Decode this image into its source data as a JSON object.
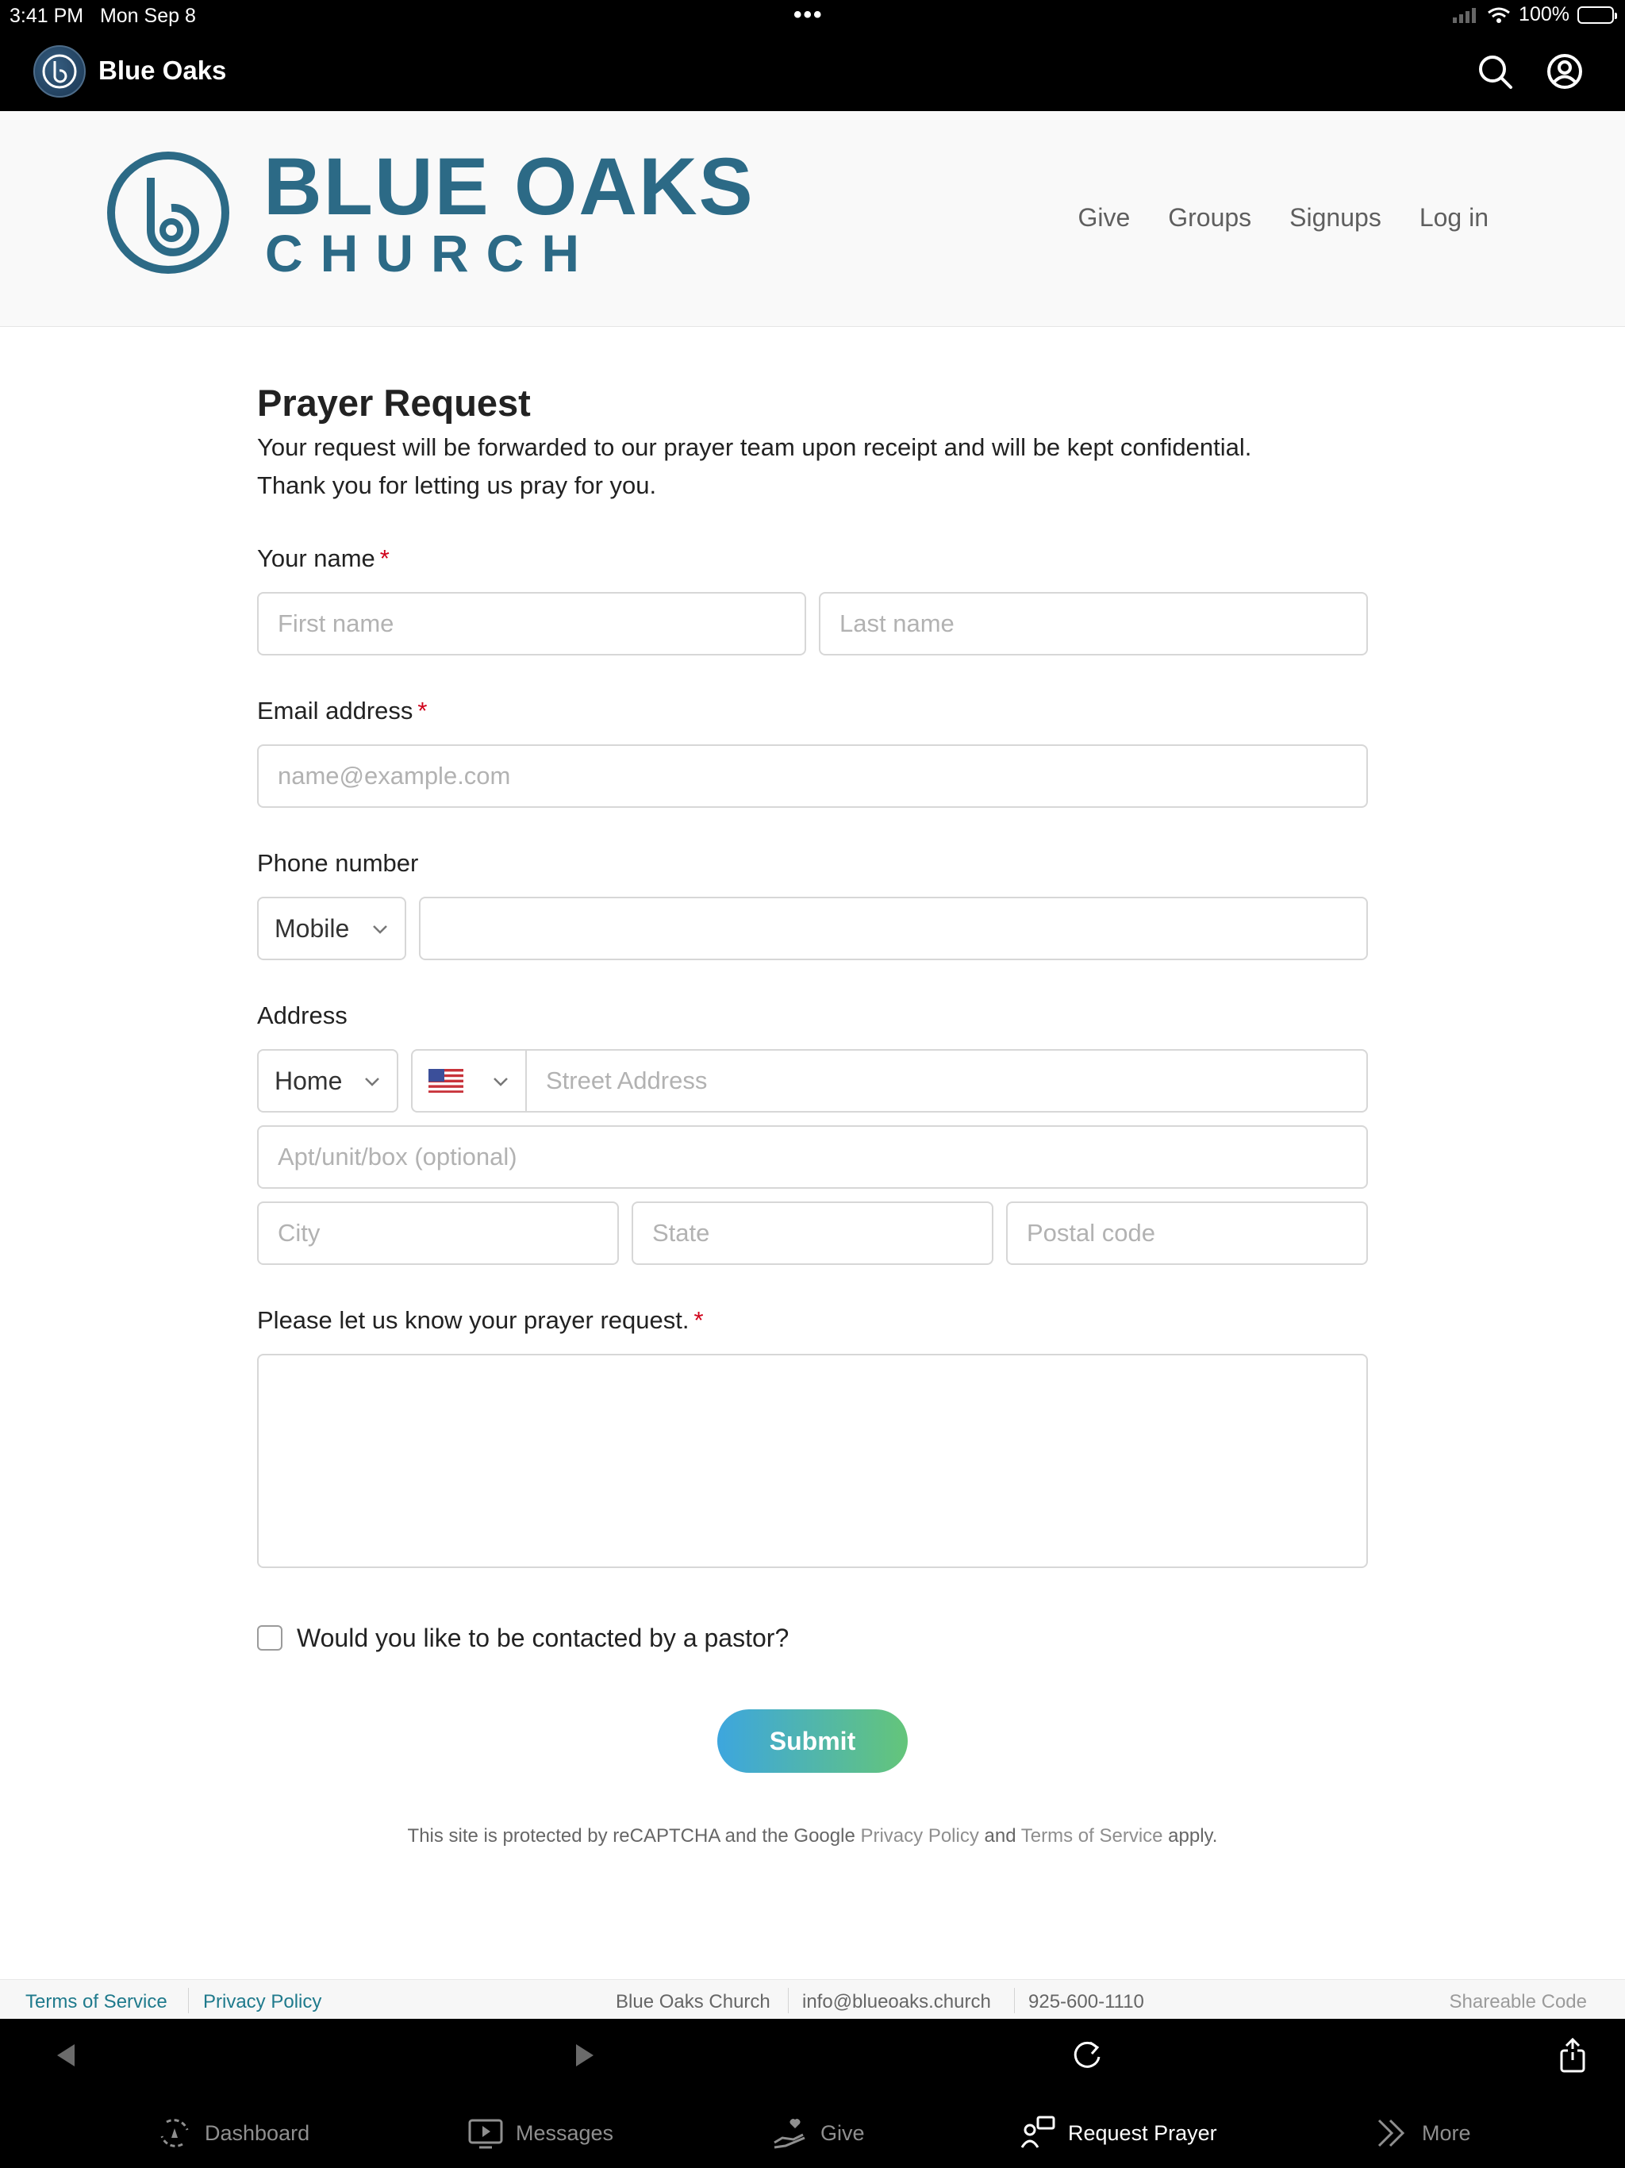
{
  "status_bar": {
    "time": "3:41 PM",
    "date": "Mon Sep 8",
    "dots": "•••",
    "battery": "100%"
  },
  "app_bar": {
    "title": "Blue Oaks",
    "icons": [
      "search-icon",
      "account-icon"
    ]
  },
  "site_header": {
    "brand_line1": "BLUE OAKS",
    "brand_line2": "CHURCH",
    "brand_color": "#2c6a86",
    "nav": [
      "Give",
      "Groups",
      "Signups",
      "Log in"
    ]
  },
  "form": {
    "title": "Prayer Request",
    "description_line1": "Your request will be forwarded to our prayer team upon receipt and will be kept confidential.",
    "description_line2": "Thank you for letting us pray for you.",
    "name_label": "Your name",
    "first_name_placeholder": "First name",
    "last_name_placeholder": "Last name",
    "email_label": "Email address",
    "email_placeholder": "name@example.com",
    "phone_label": "Phone number",
    "phone_type": "Mobile",
    "phone_value": "",
    "address_label": "Address",
    "address_type": "Home",
    "country_flag": "us-flag-icon",
    "street_placeholder": "Street Address",
    "apt_placeholder": "Apt/unit/box (optional)",
    "city_placeholder": "City",
    "state_placeholder": "State",
    "postal_placeholder": "Postal code",
    "request_label": "Please let us know your prayer request.",
    "required_marker": "*",
    "checkbox_label": "Would you like to be contacted by a pastor?",
    "checkbox_checked": false,
    "submit_label": "Submit",
    "recaptcha_prefix": "This site is protected by reCAPTCHA and the Google ",
    "recaptcha_privacy": "Privacy Policy",
    "recaptcha_and": " and ",
    "recaptcha_terms": "Terms of Service",
    "recaptcha_suffix": " apply."
  },
  "footer": {
    "terms": "Terms of Service",
    "privacy": "Privacy Policy",
    "church": "Blue Oaks Church",
    "email": "info@blueoaks.church",
    "phone": "925-600-1110",
    "shareable": "Shareable Code"
  },
  "browser_bar": {
    "icons": [
      "back-icon",
      "forward-icon",
      "reload-icon",
      "share-icon"
    ]
  },
  "tab_bar": {
    "tabs": [
      {
        "label": "Dashboard",
        "icon": "dashboard-icon",
        "active": false
      },
      {
        "label": "Messages",
        "icon": "messages-icon",
        "active": false
      },
      {
        "label": "Give",
        "icon": "give-icon",
        "active": false
      },
      {
        "label": "Request Prayer",
        "icon": "request-prayer-icon",
        "active": true
      },
      {
        "label": "More",
        "icon": "more-icon",
        "active": false
      }
    ]
  },
  "colors": {
    "required": "#d0021b",
    "footer_link": "#1f7a8c",
    "submit_gradient_start": "#3da6de",
    "submit_gradient_end": "#64c57a"
  }
}
